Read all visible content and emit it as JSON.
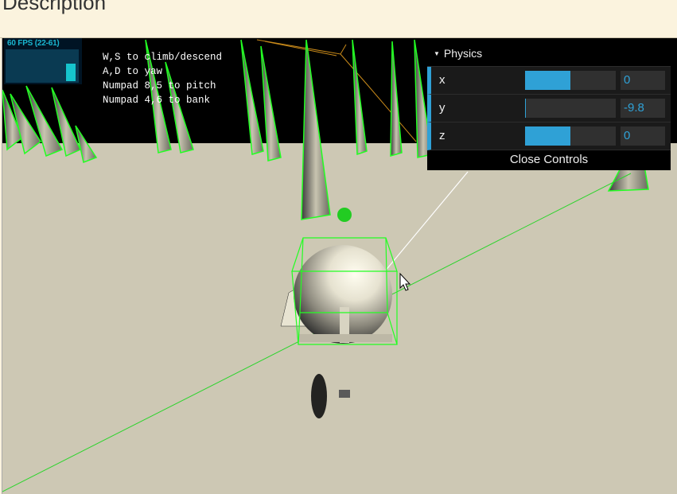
{
  "page": {
    "heading": "Description"
  },
  "stats": {
    "fps_text": "60 FPS (22-61)"
  },
  "instructions": [
    "W,S to climb/descend",
    "A,D to yaw",
    "Numpad 8,5 to pitch",
    "Numpad 4,6 to bank"
  ],
  "gui": {
    "folder_title": "Physics",
    "close_label": "Close Controls",
    "controllers": [
      {
        "label": "x",
        "value": "0",
        "fill": 0.5
      },
      {
        "label": "y",
        "value": "-9.8",
        "fill": 0.01
      },
      {
        "label": "z",
        "value": "0",
        "fill": 0.5
      }
    ]
  },
  "colors": {
    "gui_accent": "#2fa1d6",
    "stats_text": "#1ab6d0",
    "wireframe": "#22ff22",
    "ground": "#cdc8b4",
    "sky": "#000000"
  },
  "icons": {
    "cursor": "mouse-pointer-icon",
    "collapse": "triangle-down-icon"
  }
}
